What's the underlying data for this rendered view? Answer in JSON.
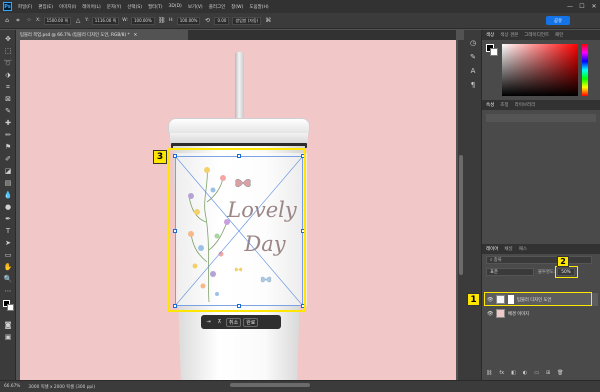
{
  "menubar": {
    "items": [
      "파일(F)",
      "편집(E)",
      "이미지(I)",
      "레이어(L)",
      "문자(Y)",
      "선택(S)",
      "필터(T)",
      "3D(D)",
      "보기(V)",
      "플러그인",
      "창(W)",
      "도움말(H)"
    ],
    "controls": [
      "—",
      "☐",
      "✕"
    ]
  },
  "options": {
    "x_label": "X:",
    "x_value": "1500.00 픽",
    "y_label": "Y:",
    "y_value": "1116.00 픽",
    "w_label": "W:",
    "w_value": "100.00%",
    "h_label": "H:",
    "h_value": "100.00%",
    "angle_value": "0.00",
    "interp": "쌍입방 (자동)",
    "share_label": "공유"
  },
  "document": {
    "tab_title": "텀블러 목업.psd @ 66.7% (텀블러 디자인 도안, RGB/8) *",
    "zoom": "66.67%",
    "doc_info": "3000 픽셀 x 2000 픽셀 (300 ppi)"
  },
  "artwork": {
    "line1": "Lovely",
    "line2": "Day"
  },
  "context_bar": {
    "buttons": [
      "⇥",
      "⊼",
      "취소",
      "완료"
    ]
  },
  "panels": {
    "color_tabs": [
      "색상",
      "색상 견본",
      "그레이디언트",
      "패턴"
    ],
    "properties_tabs": [
      "속성",
      "조정",
      "라이브러리"
    ],
    "layers_tabs": [
      "레이어",
      "채널",
      "패스"
    ],
    "search_placeholder": "종류",
    "blend_mode": "표준",
    "opacity_label": "불투명도:",
    "opacity_value": "50%",
    "layers": [
      {
        "name": "텀블러 디자인 도안"
      },
      {
        "name": "배경 이미지"
      }
    ]
  },
  "markers": {
    "one": "1",
    "two": "2",
    "three": "3"
  },
  "colors": {
    "canvas": "#f2c7c7",
    "highlight": "#ffe600",
    "accent": "#1473e6"
  }
}
